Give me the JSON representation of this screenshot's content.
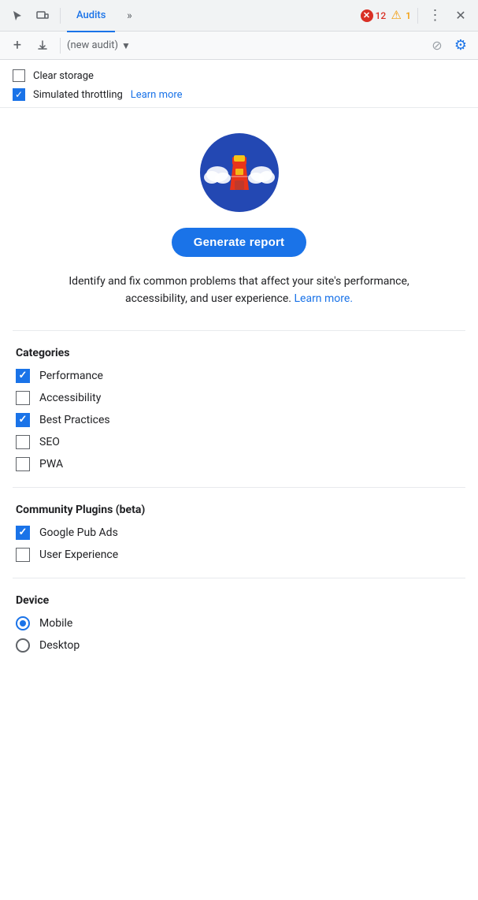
{
  "toolbar": {
    "tab_audits": "Audits",
    "error_count": "12",
    "warning_count": "1",
    "audit_placeholder": "(new audit)"
  },
  "options": {
    "clear_storage_label": "Clear storage",
    "clear_storage_checked": false,
    "simulated_throttling_label": "Simulated throttling",
    "simulated_throttling_checked": true,
    "learn_more_label": "Learn more"
  },
  "hero": {
    "generate_btn_label": "Generate report",
    "description": "Identify and fix common problems that affect your site's performance, accessibility, and user experience.",
    "learn_more_label": "Learn more",
    "learn_more_suffix": "."
  },
  "categories": {
    "title": "Categories",
    "items": [
      {
        "label": "Performance",
        "checked": true
      },
      {
        "label": "Accessibility",
        "checked": false
      },
      {
        "label": "Best Practices",
        "checked": true
      },
      {
        "label": "SEO",
        "checked": false
      },
      {
        "label": "PWA",
        "checked": false
      }
    ]
  },
  "community_plugins": {
    "title": "Community Plugins (beta)",
    "items": [
      {
        "label": "Google Pub Ads",
        "checked": true
      },
      {
        "label": "User Experience",
        "checked": false
      }
    ]
  },
  "device": {
    "title": "Device",
    "options": [
      {
        "label": "Mobile",
        "selected": true
      },
      {
        "label": "Desktop",
        "selected": false
      }
    ]
  }
}
